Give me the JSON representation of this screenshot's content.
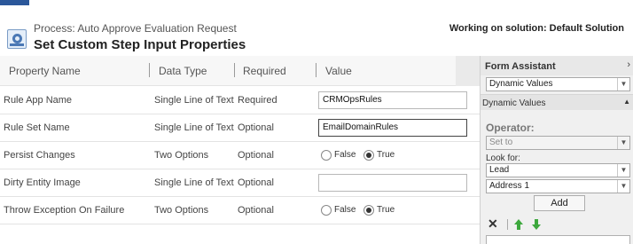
{
  "header": {
    "process_label": "Process: Auto Approve Evaluation Request",
    "title": "Set Custom Step Input Properties",
    "solution": "Working on solution: Default Solution"
  },
  "grid": {
    "columns": [
      "Property Name",
      "Data Type",
      "Required",
      "Value"
    ],
    "rows": [
      {
        "name": "Rule App Name",
        "type": "Single Line of Text",
        "required": "Required",
        "value": "CRMOpsRules"
      },
      {
        "name": "Rule Set Name",
        "type": "Single Line of Text",
        "required": "Optional",
        "value": "EmailDomainRules"
      },
      {
        "name": "Persist Changes",
        "type": "Two Options",
        "required": "Optional",
        "false_label": "False",
        "true_label": "True",
        "selected": "True"
      },
      {
        "name": "Dirty Entity Image",
        "type": "Single Line of Text",
        "required": "Optional",
        "value": ""
      },
      {
        "name": "Throw Exception On Failure",
        "type": "Two Options",
        "required": "Optional",
        "false_label": "False",
        "true_label": "True",
        "selected": "True"
      }
    ]
  },
  "assistant": {
    "title": "Form Assistant",
    "mode_select": "Dynamic Values",
    "section_label": "Dynamic Values",
    "operator_label": "Operator:",
    "operator_value": "Set to",
    "lookfor_label": "Look for:",
    "entity_select": "Lead",
    "field_select": "Address 1",
    "add_label": "Add"
  },
  "icons": {
    "process": "process-gear-icon",
    "delete": "delete-x-icon",
    "up": "green-up-arrow-icon",
    "down": "green-down-arrow-icon"
  },
  "colors": {
    "accent": "#2b579a",
    "arrow_green": "#3da83d"
  }
}
